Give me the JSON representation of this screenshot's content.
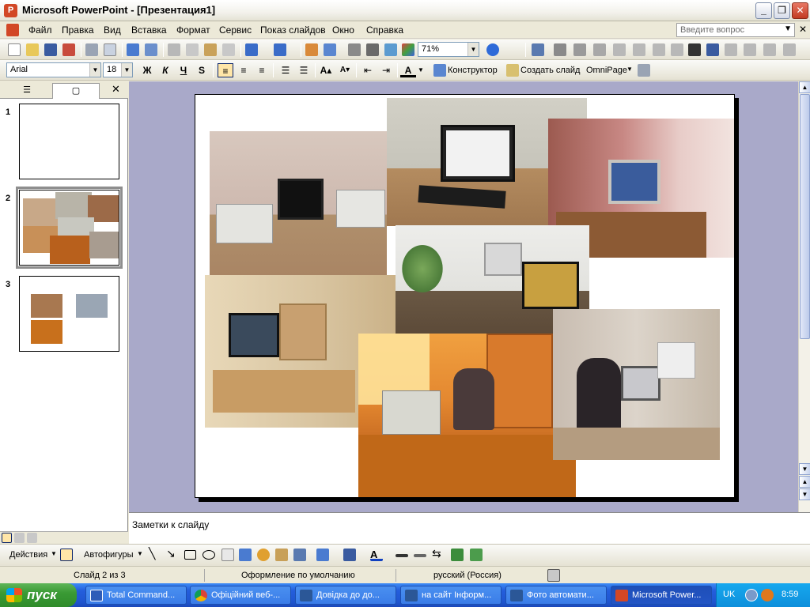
{
  "window": {
    "title": "Microsoft PowerPoint - [Презентация1]"
  },
  "menu": {
    "items": [
      "Файл",
      "Правка",
      "Вид",
      "Вставка",
      "Формат",
      "Сервис",
      "Показ слайдов",
      "Окно",
      "Справка"
    ],
    "help_placeholder": "Введите вопрос"
  },
  "toolbar": {
    "zoom": "71%",
    "font_name": "Arial",
    "font_size": "18",
    "bold": "Ж",
    "italic": "К",
    "underline": "Ч",
    "shadow": "S",
    "designer": "Конструктор",
    "new_slide": "Создать слайд",
    "omnipage": "OmniPage"
  },
  "slides_pane": {
    "numbers": [
      "1",
      "2",
      "3"
    ]
  },
  "notes": {
    "placeholder": "Заметки к слайду"
  },
  "drawing": {
    "actions": "Действия",
    "autoshapes": "Автофигуры"
  },
  "status": {
    "slide": "Слайд 2 из 3",
    "design": "Оформление по умолчанию",
    "language": "русский (Россия)"
  },
  "taskbar": {
    "start": "пуск",
    "tasks": [
      "Total Command...",
      "Офіційний веб-...",
      "Довідка до до...",
      "на сайт Інформ...",
      "Фото автомати...",
      "Microsoft Power..."
    ],
    "lang": "UK",
    "clock": "8:59"
  },
  "colors": {
    "accent": "#D24726",
    "taskbar": "#245EDC",
    "slide_bg": "#A9A9C9"
  }
}
